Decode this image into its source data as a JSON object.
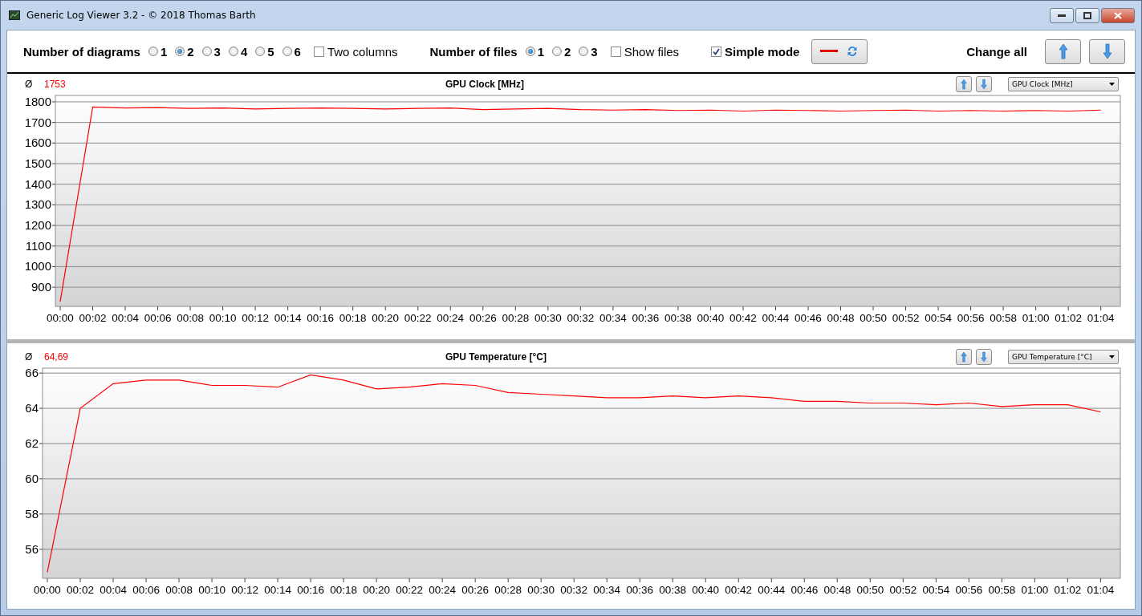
{
  "window": {
    "title": "Generic Log Viewer 3.2 - © 2018 Thomas Barth"
  },
  "toolbar": {
    "diagrams": {
      "label": "Number of diagrams",
      "options": [
        {
          "label": "1",
          "selected": false
        },
        {
          "label": "2",
          "selected": true
        },
        {
          "label": "3",
          "selected": false
        },
        {
          "label": "4",
          "selected": false
        },
        {
          "label": "5",
          "selected": false
        },
        {
          "label": "6",
          "selected": false
        }
      ]
    },
    "two_columns": {
      "label": "Two columns",
      "checked": false
    },
    "files": {
      "label": "Number of files",
      "options": [
        {
          "label": "1",
          "selected": true
        },
        {
          "label": "2",
          "selected": false
        },
        {
          "label": "3",
          "selected": false
        }
      ]
    },
    "show_files": {
      "label": "Show files",
      "checked": false
    },
    "simple_mode": {
      "label": "Simple mode",
      "checked": true
    },
    "change_all": {
      "label": "Change all"
    }
  },
  "diagrams": [
    {
      "average_symbol": "Ø",
      "average": "1753",
      "title": "GPU Clock [MHz]",
      "chart_data": {
        "type": "line",
        "grid": true,
        "x": [
          "00:00",
          "00:02",
          "00:04",
          "00:06",
          "00:08",
          "00:10",
          "00:12",
          "00:14",
          "00:16",
          "00:18",
          "00:20",
          "00:22",
          "00:24",
          "00:26",
          "00:28",
          "00:30",
          "00:32",
          "00:34",
          "00:36",
          "00:38",
          "00:40",
          "00:42",
          "00:44",
          "00:46",
          "00:48",
          "00:50",
          "00:52",
          "00:54",
          "00:56",
          "00:58",
          "01:00",
          "01:02",
          "01:04"
        ],
        "series": [
          {
            "name": "GPU Clock [MHz]",
            "color": "#ff0000",
            "values": [
              830,
              1775,
              1770,
              1772,
              1768,
              1770,
              1765,
              1768,
              1770,
              1768,
              1765,
              1768,
              1770,
              1762,
              1765,
              1768,
              1762,
              1760,
              1762,
              1758,
              1760,
              1755,
              1760,
              1758,
              1755,
              1758,
              1760,
              1755,
              1758,
              1755,
              1758,
              1755,
              1760
            ]
          }
        ],
        "ylim": [
          807,
          1831
        ],
        "yticks": [
          900,
          1000,
          1100,
          1200,
          1300,
          1400,
          1500,
          1600,
          1700,
          1800
        ]
      }
    },
    {
      "average_symbol": "Ø",
      "average": "64,69",
      "title": "GPU Temperature [°C]",
      "chart_data": {
        "type": "line",
        "grid": true,
        "x": [
          "00:00",
          "00:02",
          "00:04",
          "00:06",
          "00:08",
          "00:10",
          "00:12",
          "00:14",
          "00:16",
          "00:18",
          "00:20",
          "00:22",
          "00:24",
          "00:26",
          "00:28",
          "00:30",
          "00:32",
          "00:34",
          "00:36",
          "00:38",
          "00:40",
          "00:42",
          "00:44",
          "00:46",
          "00:48",
          "00:50",
          "00:52",
          "00:54",
          "00:56",
          "00:58",
          "01:00",
          "01:02",
          "01:04"
        ],
        "series": [
          {
            "name": "GPU Temperature [°C]",
            "color": "#ff0000",
            "values": [
              54.7,
              64.0,
              65.4,
              65.6,
              65.6,
              65.3,
              65.3,
              65.2,
              65.9,
              65.6,
              65.1,
              65.2,
              65.4,
              65.3,
              64.9,
              64.8,
              64.7,
              64.6,
              64.6,
              64.7,
              64.6,
              64.7,
              64.6,
              64.4,
              64.4,
              64.3,
              64.3,
              64.2,
              64.3,
              64.1,
              64.2,
              64.2,
              63.8
            ]
          }
        ],
        "ylim": [
          54.35,
          66.28
        ],
        "yticks": [
          56,
          58,
          60,
          62,
          64,
          66
        ]
      }
    }
  ]
}
